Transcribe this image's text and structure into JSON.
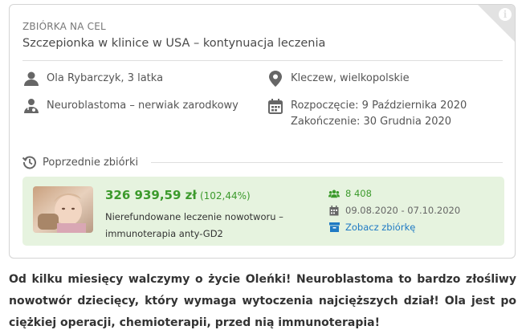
{
  "card": {
    "eyebrow": "ZBIÓRKA NA CEL",
    "title": "Szczepionka w klinice w USA – kontynuacja leczenia",
    "person": "Ola Rybarczyk, 3 latka",
    "location": "Kleczew, wielkopolskie",
    "diagnosis": "Neuroblastoma – nerwiak zarodkowy",
    "start": "Rozpoczęcie: 9 Października 2020",
    "end": "Zakończenie: 30 Grudnia 2020",
    "info_icon": "i"
  },
  "previous": {
    "label": "Poprzednie zbiórki",
    "amount": "326 939,59 zł",
    "percent": "(102,44%)",
    "description": "Nierefundowane leczenie nowotworu – immunoterapia anty-GD2",
    "supporters": "8 408",
    "dates": "09.08.2020 - 07.10.2020",
    "link": "Zobacz zbiórkę"
  },
  "body": {
    "text": "Od kilku miesięcy walczymy o życie Oleńki! Neuroblastoma to bardzo złośliwy nowotwór dziecięcy, który wymaga wytoczenia najcięższych dział! Ola jest po ciężkiej operacji, chemioterapii, przed nią immunoterapia!"
  },
  "colors": {
    "accent_green": "#3c9a2c",
    "link_blue": "#1f7ac4",
    "box_bg": "#e6f3df",
    "icon_gray": "#666666"
  },
  "icons": [
    "info-icon",
    "user-icon",
    "location-pin-icon",
    "doctor-icon",
    "calendar-icon",
    "history-icon",
    "users-icon",
    "calendar-small-icon",
    "archive-icon"
  ]
}
